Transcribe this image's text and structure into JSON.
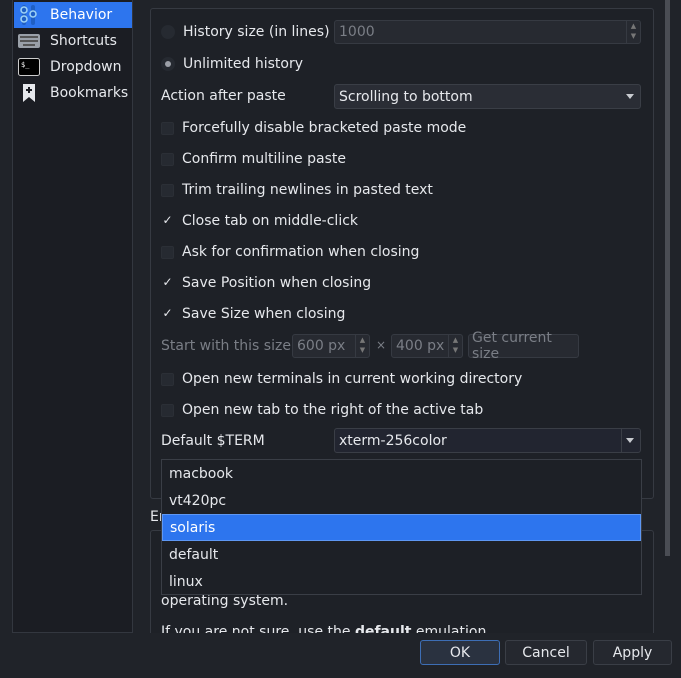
{
  "sidebar": {
    "items": [
      {
        "label": "Behavior",
        "icon": "sliders-icon",
        "active": true
      },
      {
        "label": "Shortcuts",
        "icon": "keyboard-icon"
      },
      {
        "label": "Dropdown",
        "icon": "terminal-icon"
      },
      {
        "label": "Bookmarks",
        "icon": "bookmark-icon"
      }
    ]
  },
  "behavior": {
    "group_title": "Behavior",
    "history_size_label": "History size (in lines)",
    "history_size_value": "1000",
    "unlimited_label": "Unlimited history",
    "action_after_paste_label": "Action after paste",
    "action_after_paste_value": "Scrolling to bottom",
    "checkboxes": [
      {
        "label": "Forcefully disable bracketed paste mode",
        "checked": false
      },
      {
        "label": "Confirm multiline paste",
        "checked": false
      },
      {
        "label": "Trim trailing newlines in pasted text",
        "checked": false
      },
      {
        "label": "Close tab on middle-click",
        "checked": true
      },
      {
        "label": "Ask for confirmation when closing",
        "checked": false
      },
      {
        "label": "Save Position when closing",
        "checked": true
      },
      {
        "label": "Save Size when closing",
        "checked": true
      }
    ],
    "start_size_label": "Start with this size:",
    "width_value": "600 px",
    "times": "×",
    "height_value": "400 px",
    "get_size_label": "Get current size",
    "open_cwd_label": "Open new terminals in current working directory",
    "open_right_label": "Open new tab to the right of the active tab",
    "term_label": "Default $TERM",
    "term_value": "xterm-256color",
    "term_options": [
      "macbook",
      "vt420pc",
      "solaris",
      "default",
      "linux"
    ],
    "term_highlighted": "solaris"
  },
  "emulation": {
    "group_title_partial": "Em",
    "text_line1": "operating system.",
    "text_line2_pre": "If you are not sure, use the ",
    "text_line2_bold": "default",
    "text_line2_post": " emulation."
  },
  "buttons": {
    "ok": "OK",
    "cancel": "Cancel",
    "apply": "Apply"
  },
  "colors": {
    "accent": "#2d75ee",
    "background": "#202329"
  }
}
